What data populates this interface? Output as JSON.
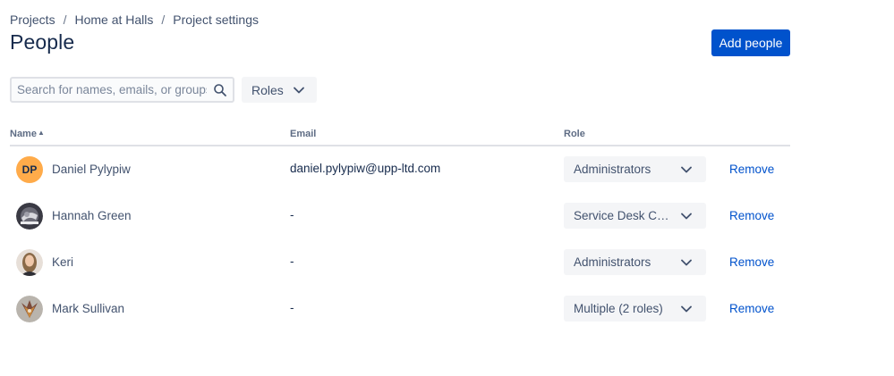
{
  "breadcrumb": {
    "items": [
      "Projects",
      "Home at Halls",
      "Project settings"
    ],
    "separator": "/"
  },
  "page": {
    "title": "People"
  },
  "toolbar": {
    "add_label": "Add people",
    "search_placeholder": "Search for names, emails, or groups",
    "roles_label": "Roles"
  },
  "table": {
    "headers": {
      "name": "Name",
      "email": "Email",
      "role": "Role"
    },
    "rows": [
      {
        "initials": "DP",
        "name": "Daniel Pylypiw",
        "email": "daniel.pylypiw@upp-ltd.com",
        "role": "Administrators",
        "action": "Remove"
      },
      {
        "initials": "",
        "name": "Hannah Green",
        "email": "-",
        "role": "Service Desk Customers",
        "action": "Remove"
      },
      {
        "initials": "",
        "name": "Keri",
        "email": "-",
        "role": "Administrators",
        "action": "Remove"
      },
      {
        "initials": "",
        "name": "Mark Sullivan",
        "email": "-",
        "role": "Multiple (2 roles)",
        "action": "Remove"
      }
    ]
  },
  "colors": {
    "primary": "#0052cc",
    "text": "#172b4d",
    "subtle": "#42526e",
    "avatar_dp": "#ffab4a"
  }
}
